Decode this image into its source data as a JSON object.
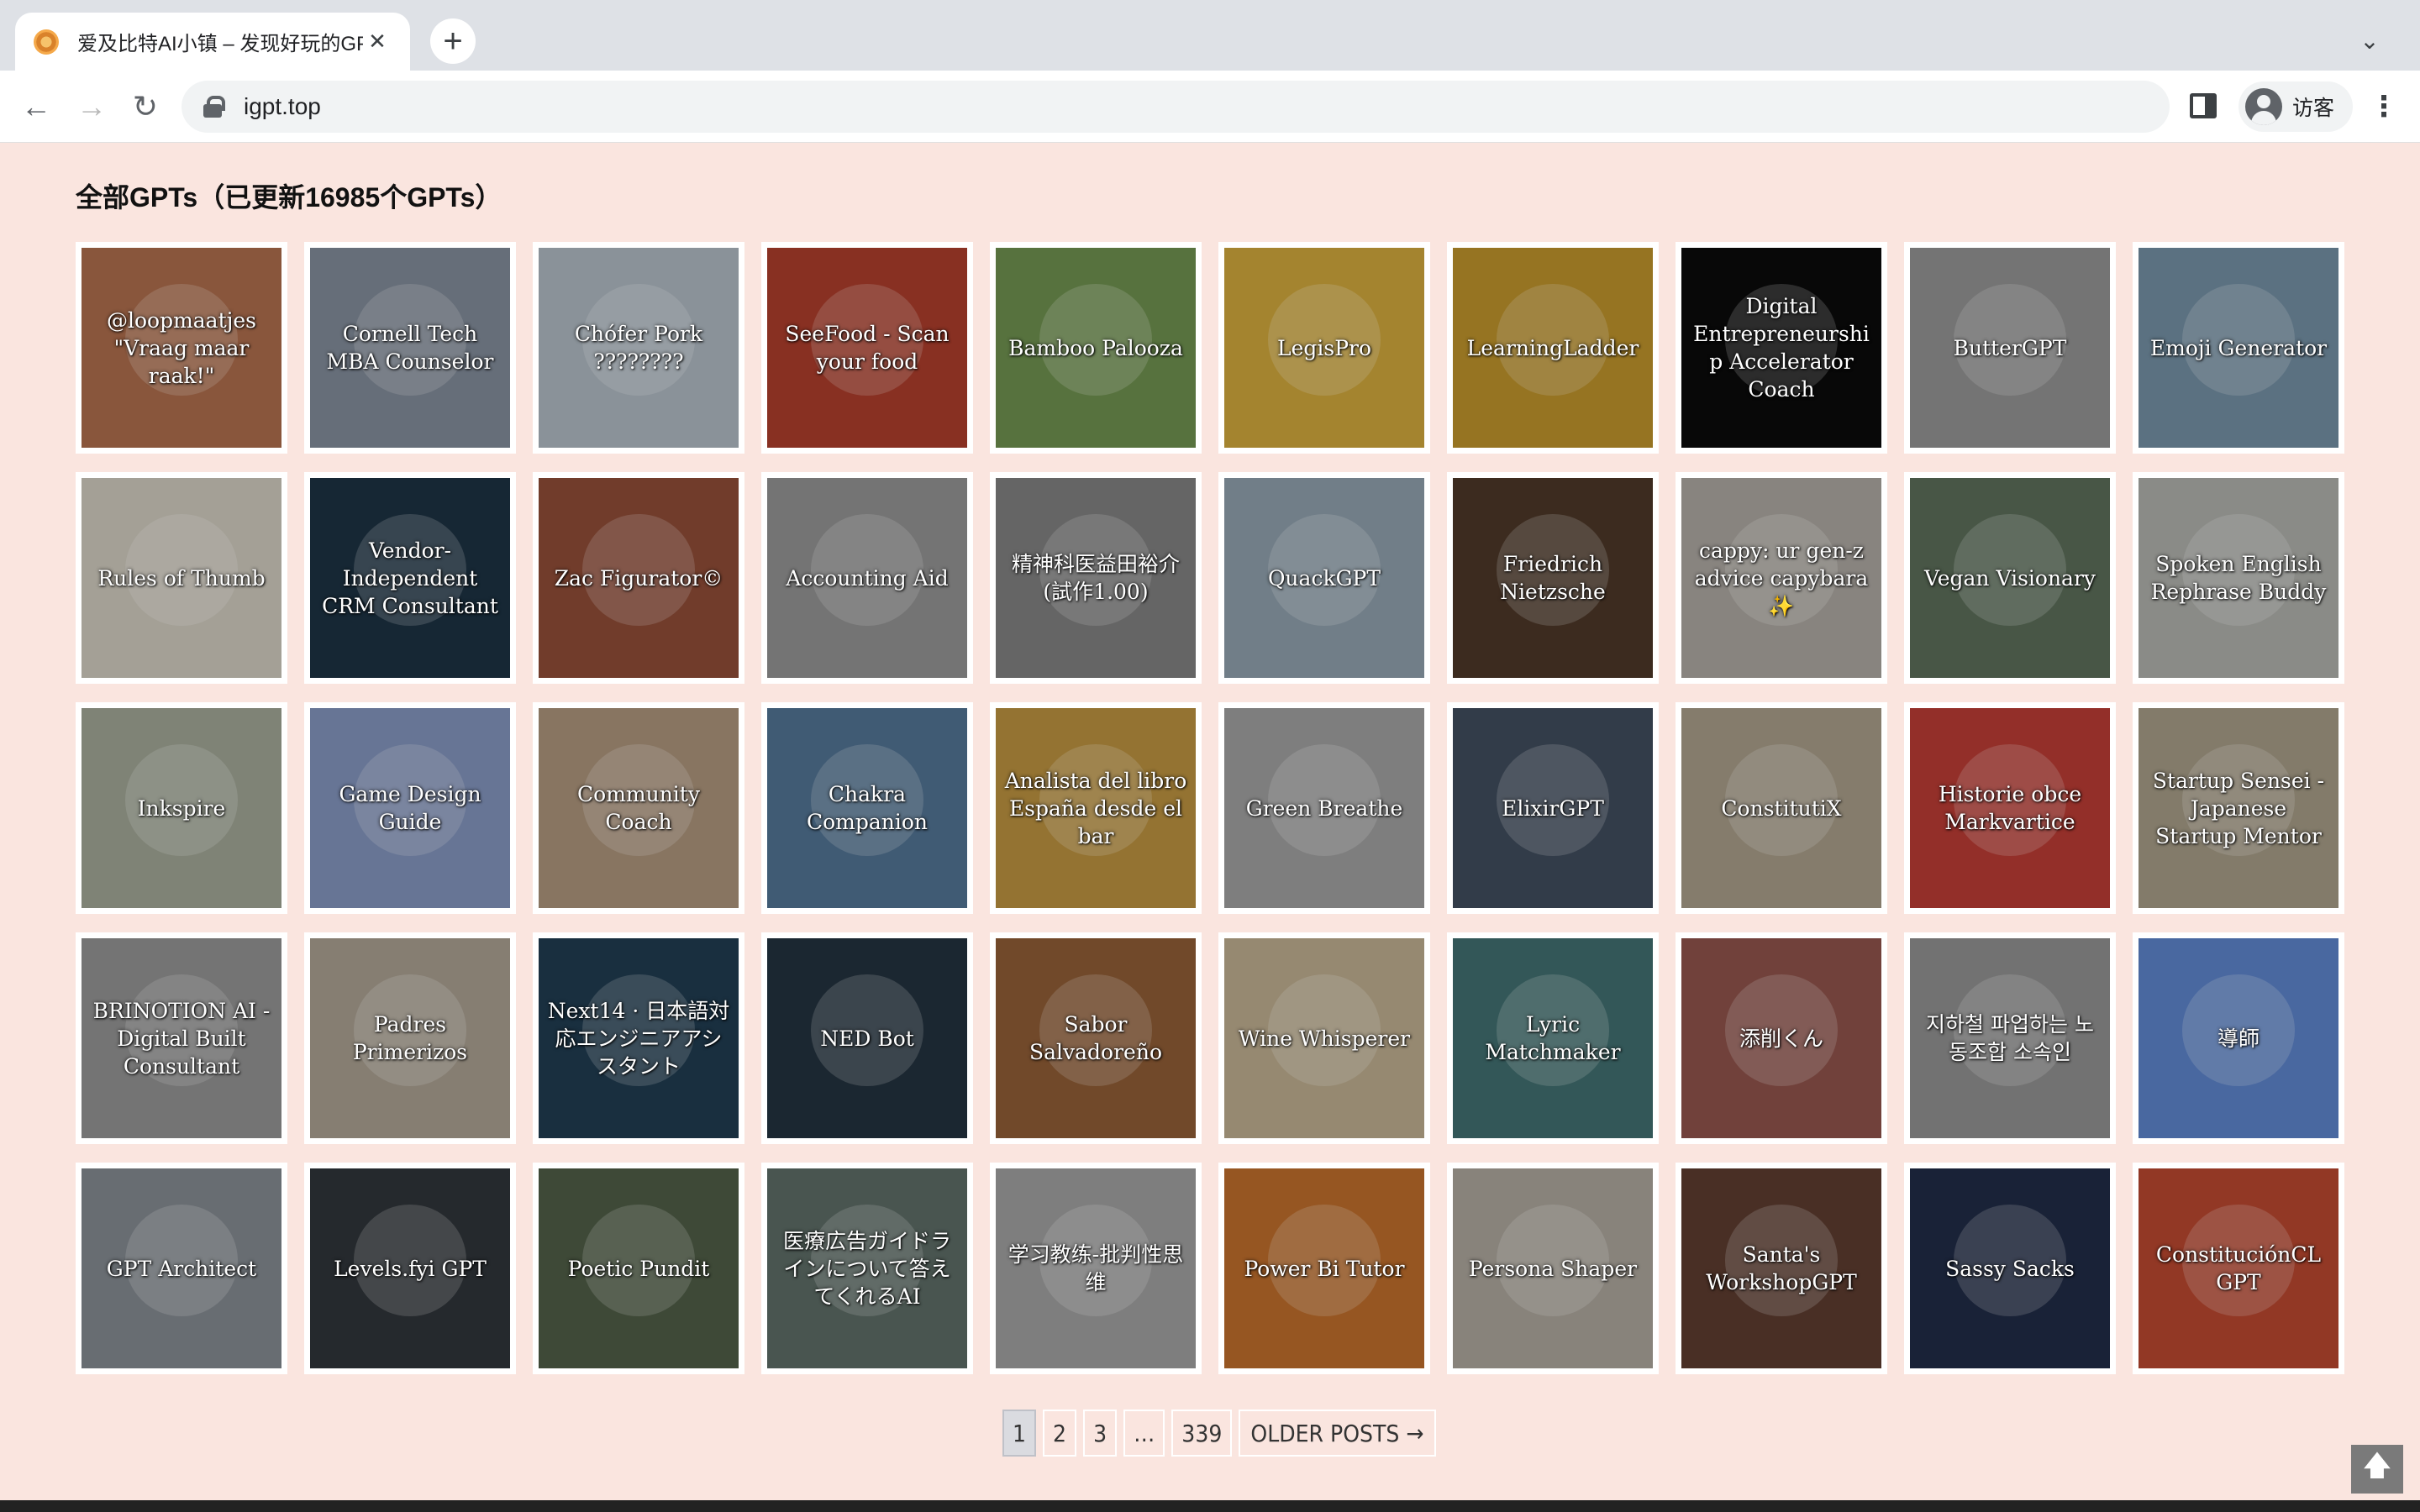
{
  "browser": {
    "tab_title": "爱及比特AI小镇 – 发现好玩的GPTs",
    "url": "igpt.top",
    "profile_label": "访客"
  },
  "page": {
    "heading": "全部GPTs（已更新16985个GPTs）"
  },
  "cards": [
    {
      "title": "@loopmaatjes \"Vraag maar raak!\"",
      "color": "#a8694a"
    },
    {
      "title": "Cornell Tech MBA Counselor",
      "color": "#7d8794"
    },
    {
      "title": "Chófer Pork ????????",
      "color": "#a9b3bb"
    },
    {
      "title": "SeeFood - Scan your food",
      "color": "#a63b2a"
    },
    {
      "title": "Bamboo Palooza",
      "color": "#6b8c4c"
    },
    {
      "title": "LegisPro",
      "color": "#c9a23a"
    },
    {
      "title": "LearningLadder",
      "color": "#b88e2a"
    },
    {
      "title": "Digital Entrepreneurship Accelerator Coach",
      "color": "#0a0a0a"
    },
    {
      "title": "ButterGPT",
      "color": "#8e8e8e"
    },
    {
      "title": "Emoji Generator",
      "color": "#6f8a9e"
    },
    {
      "title": "Rules of Thumb",
      "color": "#c8c4b8"
    },
    {
      "title": "Vendor-Independent CRM Consultant",
      "color": "#1c3040"
    },
    {
      "title": "Zac Figurator©",
      "color": "#8a4a35"
    },
    {
      "title": "Accounting Aid",
      "color": "#8e8e8e"
    },
    {
      "title": "精神科医益田裕介(試作1.00)",
      "color": "#7c7c7c"
    },
    {
      "title": "QuackGPT",
      "color": "#8a9aa6"
    },
    {
      "title": "Friedrich Nietzsche",
      "color": "#4a3526"
    },
    {
      "title": "cappy: ur gen-z advice capybara ✨",
      "color": "#a6a19b"
    },
    {
      "title": "Vegan Visionary",
      "color": "#586a56"
    },
    {
      "title": "Spoken English Rephrase Buddy",
      "color": "#a9aaa5"
    },
    {
      "title": "Inkspire",
      "color": "#9ba090"
    },
    {
      "title": "Game Design Guide",
      "color": "#7e8fb6"
    },
    {
      "title": "Community Coach",
      "color": "#a68f77"
    },
    {
      "title": "Chakra Companion",
      "color": "#4f6f8e"
    },
    {
      "title": "Analista del libro España desde el bar",
      "color": "#b58d3e"
    },
    {
      "title": "Green Breathe",
      "color": "#9a9a9a"
    },
    {
      "title": "ElixirGPT",
      "color": "#3e4a5a"
    },
    {
      "title": "ConstitutiX",
      "color": "#a39884"
    },
    {
      "title": "Historie obce Markvartice",
      "color": "#b43a32"
    },
    {
      "title": "Startup Sensei - Japanese Startup Mentor",
      "color": "#a09782"
    },
    {
      "title": "BRINOTION AI - Digital Built Consultant",
      "color": "#8e8e8e"
    },
    {
      "title": "Padres Primerizos",
      "color": "#a49a8c"
    },
    {
      "title": "Next14 · 日本語対応エンジニアアシスタント",
      "color": "#1f3a4e"
    },
    {
      "title": "NED Bot",
      "color": "#22303c"
    },
    {
      "title": "Sabor Salvadoreño",
      "color": "#8a5a34"
    },
    {
      "title": "Wine Whisperer",
      "color": "#b8a88a"
    },
    {
      "title": "Lyric Matchmaker",
      "color": "#3f6b6c"
    },
    {
      "title": "添削くん",
      "color": "#8a5048"
    },
    {
      "title": "지하철 파업하는 노동조합 소속인",
      "color": "#8c8c8c"
    },
    {
      "title": "導師",
      "color": "#5a7fc4"
    },
    {
      "title": "GPT Architect",
      "color": "#7f858c"
    },
    {
      "title": "Levels.fyi GPT",
      "color": "#2e3338"
    },
    {
      "title": "Poetic Pundit",
      "color": "#4c5a44"
    },
    {
      "title": "医療広告ガイドラインについて答えてくれるAI",
      "color": "#5a6862"
    },
    {
      "title": "学习教练-批判性思维",
      "color": "#9a9a9a"
    },
    {
      "title": "Power Bi Tutor",
      "color": "#b86a2a"
    },
    {
      "title": "Persona Shaper",
      "color": "#a6a097"
    },
    {
      "title": "Santa's WorkshopGPT",
      "color": "#5a3a2e"
    },
    {
      "title": "Sassy Sacks",
      "color": "#1f2a44"
    },
    {
      "title": "ConstituciónCL GPT",
      "color": "#b3452e"
    }
  ],
  "pagination": {
    "pages": [
      "1",
      "2",
      "3",
      "…",
      "339"
    ],
    "current": "1",
    "older_label": "OLDER POSTS →"
  },
  "icons": {
    "back_to_top": "arrow-up-icon"
  }
}
